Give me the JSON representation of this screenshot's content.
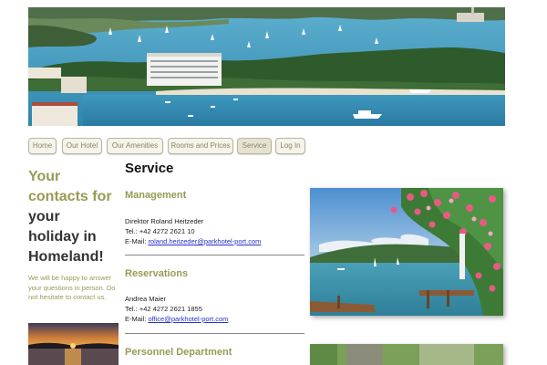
{
  "nav": {
    "items": [
      {
        "label": "Home"
      },
      {
        "label": "Our Hotel"
      },
      {
        "label": "Our Amenities"
      },
      {
        "label": "Rooms and Prices"
      },
      {
        "label": "Service",
        "active": true
      },
      {
        "label": "Log In"
      }
    ]
  },
  "sidebar": {
    "tagline_green_1": "Your",
    "tagline_green_2": "contacts for",
    "tagline_dark_1": "your",
    "tagline_dark_2": "holiday in",
    "tagline_dark_3": "Homeland!",
    "intro": "We will be happy to answer your questions in person. Do not hesitate to contact us."
  },
  "main": {
    "title": "Service",
    "sections": [
      {
        "heading": "Management",
        "name": "Direktor Roland Heitzeder",
        "tel_label": "Tel.:",
        "tel": "+42 4272 2621 10",
        "email_label": "E-Mail:",
        "email": "roland.heitzeder@parkhotel-port.com"
      },
      {
        "heading": "Reservations",
        "name": "Andrea Maier",
        "tel_label": "Tel.:",
        "tel": "+42 4272 2621 1855",
        "email_label": "E-Mail:",
        "email": "office@parkhotel-port.com"
      },
      {
        "heading": "Personnel Department"
      }
    ]
  },
  "colors": {
    "accent_olive": "#9a9a55",
    "link_blue": "#2433c9",
    "nav_border": "#b9b398"
  }
}
